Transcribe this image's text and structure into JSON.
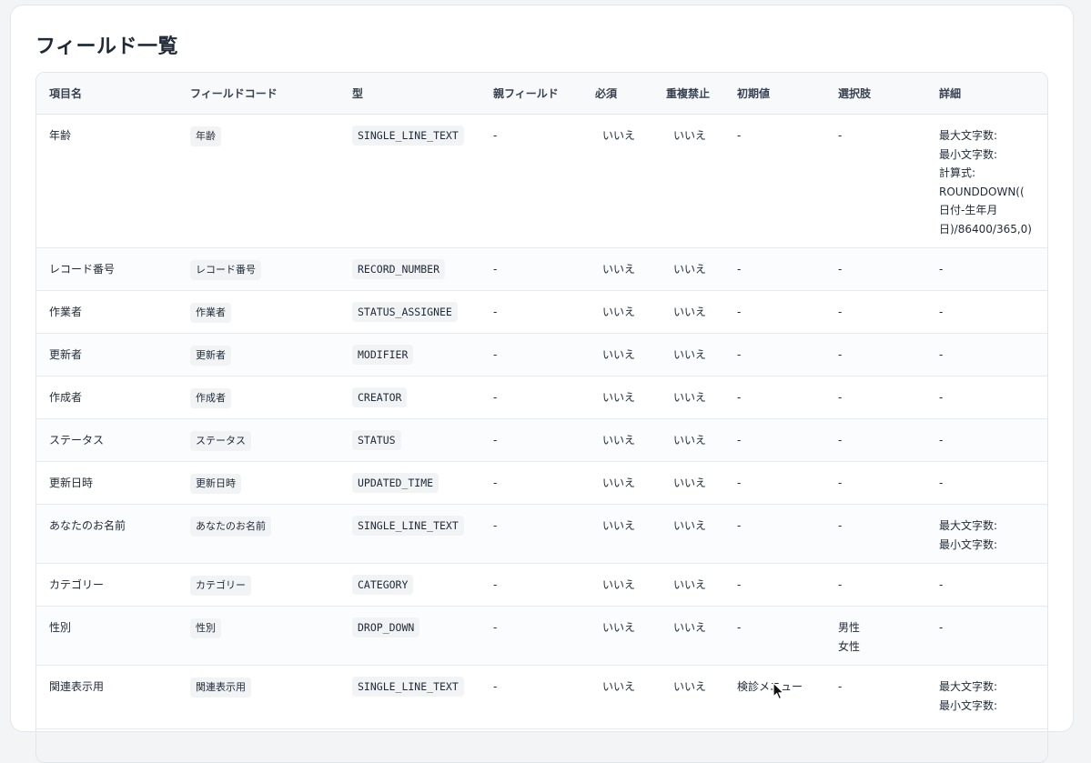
{
  "page": {
    "title": "フィールド一覧"
  },
  "table": {
    "headers": [
      "項目名",
      "フィールドコード",
      "型",
      "親フィールド",
      "必須",
      "重複禁止",
      "初期値",
      "選択肢",
      "詳細"
    ],
    "rows": [
      {
        "name": "年齢",
        "code": "年齢",
        "type": "SINGLE_LINE_TEXT",
        "parent": "-",
        "required": "いいえ",
        "unique": "いいえ",
        "default": "-",
        "options": [
          "-"
        ],
        "details": [
          "最大文字数:",
          "最小文字数:",
          "計算式:",
          "ROUNDDOWN((",
          "日付-生年月",
          "日)/86400/365,0)"
        ]
      },
      {
        "name": "レコード番号",
        "code": "レコード番号",
        "type": "RECORD_NUMBER",
        "parent": "-",
        "required": "いいえ",
        "unique": "いいえ",
        "default": "-",
        "options": [
          "-"
        ],
        "details": [
          "-"
        ]
      },
      {
        "name": "作業者",
        "code": "作業者",
        "type": "STATUS_ASSIGNEE",
        "parent": "-",
        "required": "いいえ",
        "unique": "いいえ",
        "default": "-",
        "options": [
          "-"
        ],
        "details": [
          "-"
        ]
      },
      {
        "name": "更新者",
        "code": "更新者",
        "type": "MODIFIER",
        "parent": "-",
        "required": "いいえ",
        "unique": "いいえ",
        "default": "-",
        "options": [
          "-"
        ],
        "details": [
          "-"
        ]
      },
      {
        "name": "作成者",
        "code": "作成者",
        "type": "CREATOR",
        "parent": "-",
        "required": "いいえ",
        "unique": "いいえ",
        "default": "-",
        "options": [
          "-"
        ],
        "details": [
          "-"
        ]
      },
      {
        "name": "ステータス",
        "code": "ステータス",
        "type": "STATUS",
        "parent": "-",
        "required": "いいえ",
        "unique": "いいえ",
        "default": "-",
        "options": [
          "-"
        ],
        "details": [
          "-"
        ]
      },
      {
        "name": "更新日時",
        "code": "更新日時",
        "type": "UPDATED_TIME",
        "parent": "-",
        "required": "いいえ",
        "unique": "いいえ",
        "default": "-",
        "options": [
          "-"
        ],
        "details": [
          "-"
        ]
      },
      {
        "name": "あなたのお名前",
        "code": "あなたのお名前",
        "type": "SINGLE_LINE_TEXT",
        "parent": "-",
        "required": "いいえ",
        "unique": "いいえ",
        "default": "-",
        "options": [
          "-"
        ],
        "details": [
          "最大文字数:",
          "最小文字数:"
        ]
      },
      {
        "name": "カテゴリー",
        "code": "カテゴリー",
        "type": "CATEGORY",
        "parent": "-",
        "required": "いいえ",
        "unique": "いいえ",
        "default": "-",
        "options": [
          "-"
        ],
        "details": [
          "-"
        ]
      },
      {
        "name": "性別",
        "code": "性別",
        "type": "DROP_DOWN",
        "parent": "-",
        "required": "いいえ",
        "unique": "いいえ",
        "default": "-",
        "options": [
          "男性",
          "女性"
        ],
        "details": [
          "-"
        ]
      },
      {
        "name": "関連表示用",
        "code": "関連表示用",
        "type": "SINGLE_LINE_TEXT",
        "parent": "-",
        "required": "いいえ",
        "unique": "いいえ",
        "default": "検診メニュー",
        "options": [
          "-"
        ],
        "details": [
          "最大文字数:",
          "最小文字数:"
        ]
      }
    ]
  }
}
